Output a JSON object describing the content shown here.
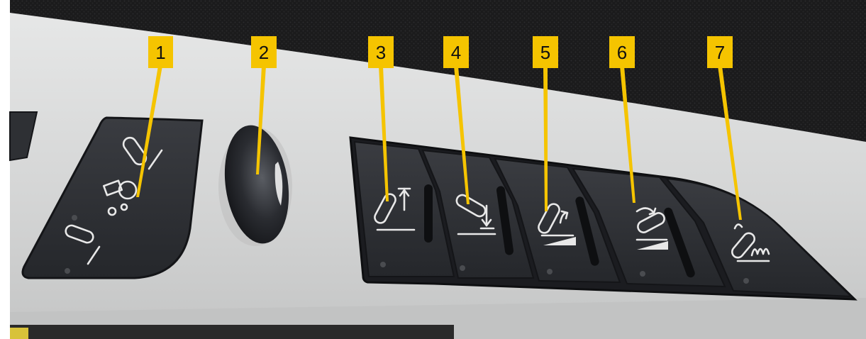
{
  "colors": {
    "panel": "#2c2e33",
    "panel_edge": "#15161a",
    "housing": "#dcdddd",
    "callout": "#f5c400"
  },
  "callouts": [
    {
      "label": "1",
      "target": "auto-conveyor-mode-button"
    },
    {
      "label": "2",
      "target": "rocker-knob"
    },
    {
      "label": "3",
      "target": "raise-belt-button"
    },
    {
      "label": "4",
      "target": "lower-belt-button"
    },
    {
      "label": "5",
      "target": "belt-tilt-up-button"
    },
    {
      "label": "6",
      "target": "belt-tilt-down-button"
    },
    {
      "label": "7",
      "target": "belt-float-button"
    }
  ]
}
